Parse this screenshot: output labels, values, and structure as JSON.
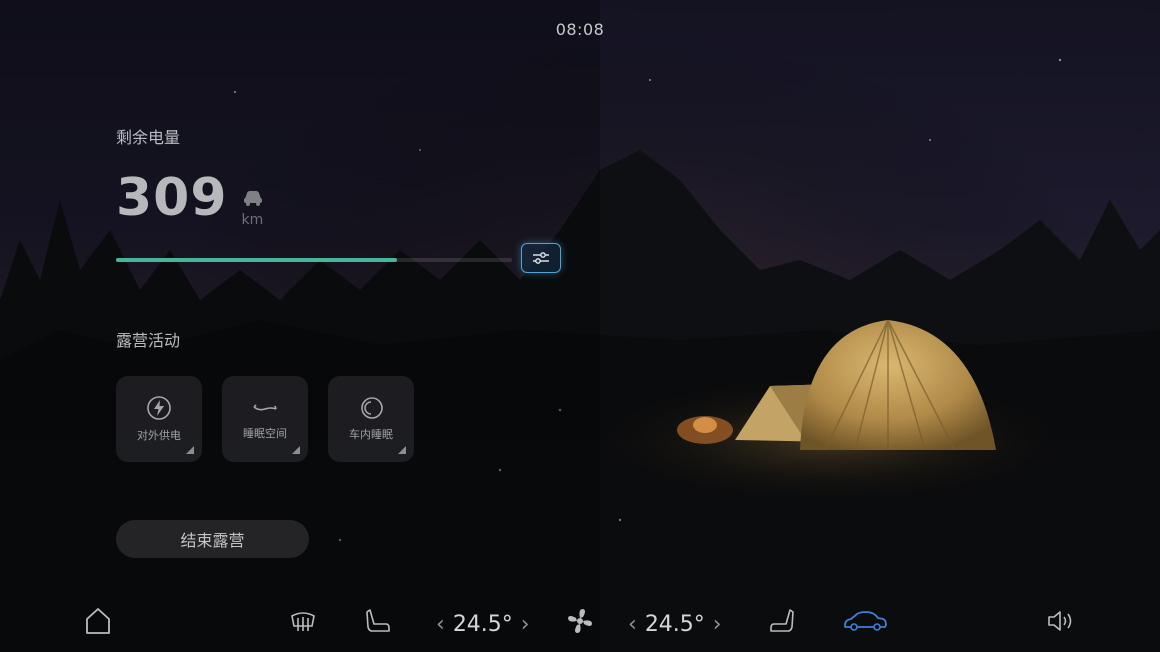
{
  "status": {
    "time": "08:08"
  },
  "battery": {
    "title": "剩余电量",
    "range_value": "309",
    "range_unit": "km",
    "level_percent": 71
  },
  "camping": {
    "title": "露营活动",
    "tiles": [
      {
        "label": "对外供电",
        "icon": "lightning-icon"
      },
      {
        "label": "睡眠空间",
        "icon": "sleep-space-icon"
      },
      {
        "label": "车内睡眠",
        "icon": "moon-sleep-icon"
      }
    ],
    "end_button": "结束露营"
  },
  "dock": {
    "left_temp": "24.5°",
    "right_temp": "24.5°",
    "icons": [
      "home-icon",
      "rear-defrost-icon",
      "driver-seat-icon",
      "fan-icon",
      "passenger-seat-icon",
      "car-icon",
      "volume-icon"
    ],
    "active_color": "#3f7fd9",
    "accent_color": "#46b59c"
  }
}
